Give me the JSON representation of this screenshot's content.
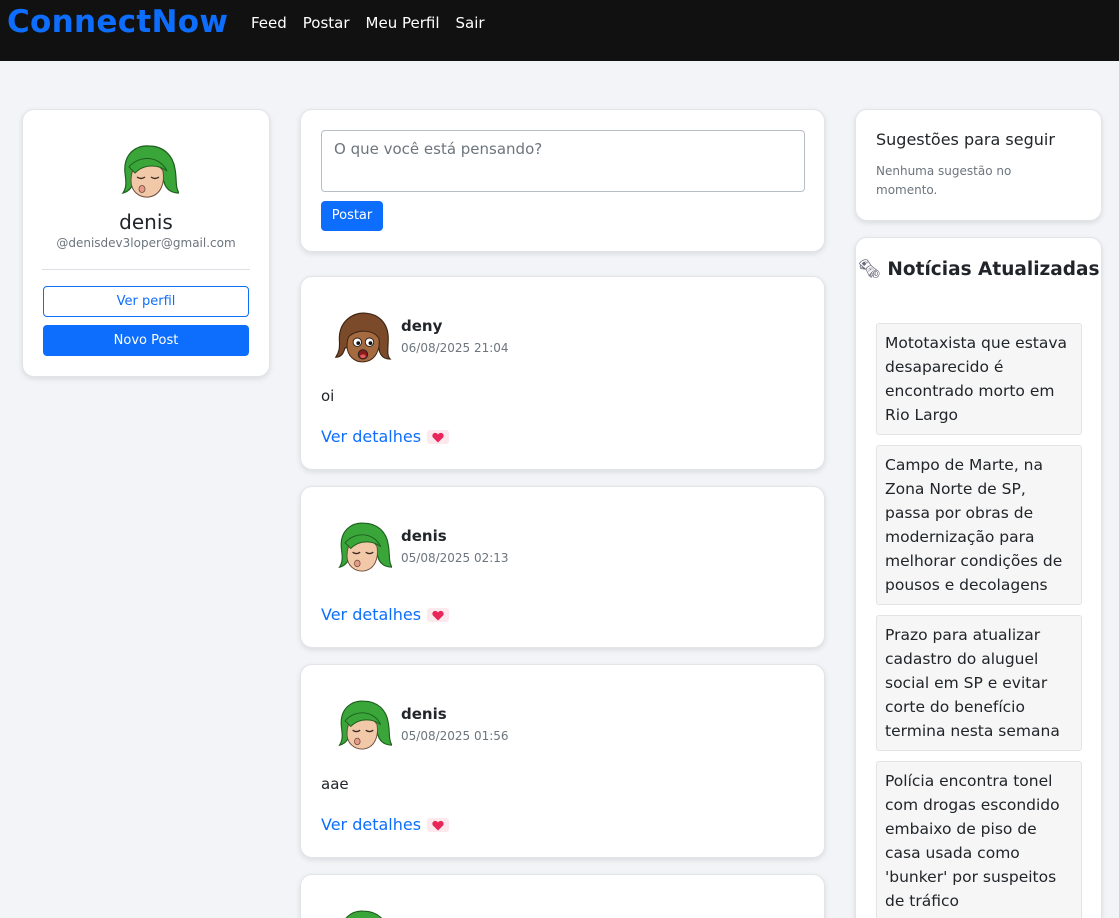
{
  "navbar": {
    "brand": "ConnectNow",
    "links": [
      "Feed",
      "Postar",
      "Meu Perfil",
      "Sair"
    ]
  },
  "profile": {
    "name": "denis",
    "email": "@denisdev3loper@gmail.com",
    "view_profile_label": "Ver perfil",
    "new_post_label": "Novo Post"
  },
  "compose": {
    "placeholder": "O que você está pensando?",
    "submit_label": "Postar"
  },
  "posts": [
    {
      "author": "deny",
      "date": "06/08/2025 21:04",
      "text": "oi",
      "link": "Ver detalhes"
    },
    {
      "author": "denis",
      "date": "05/08/2025 02:13",
      "text": "",
      "link": "Ver detalhes"
    },
    {
      "author": "denis",
      "date": "05/08/2025 01:56",
      "text": "aae",
      "link": "Ver detalhes"
    }
  ],
  "suggestions": {
    "title": "Sugestões para seguir",
    "empty": "Nenhuma sugestão no momento."
  },
  "news": {
    "title": "Notícias Atualizadas",
    "icon": "newspaper-icon",
    "items": [
      "Mototaxista que estava desaparecido é encontrado morto em Rio Largo",
      "Campo de Marte, na Zona Norte de SP, passa por obras de modernização para melhorar condições de pousos e decolagens",
      "Prazo para atualizar cadastro do aluguel social em SP e evitar corte do benefício termina nesta semana",
      "Polícia encontra tonel com drogas escondido embaixo de piso de casa usada como 'bunker' por suspeitos de tráfico"
    ]
  },
  "colors": {
    "accent": "#0d6efd",
    "navbar": "#111111",
    "background": "#f2f4f7"
  }
}
